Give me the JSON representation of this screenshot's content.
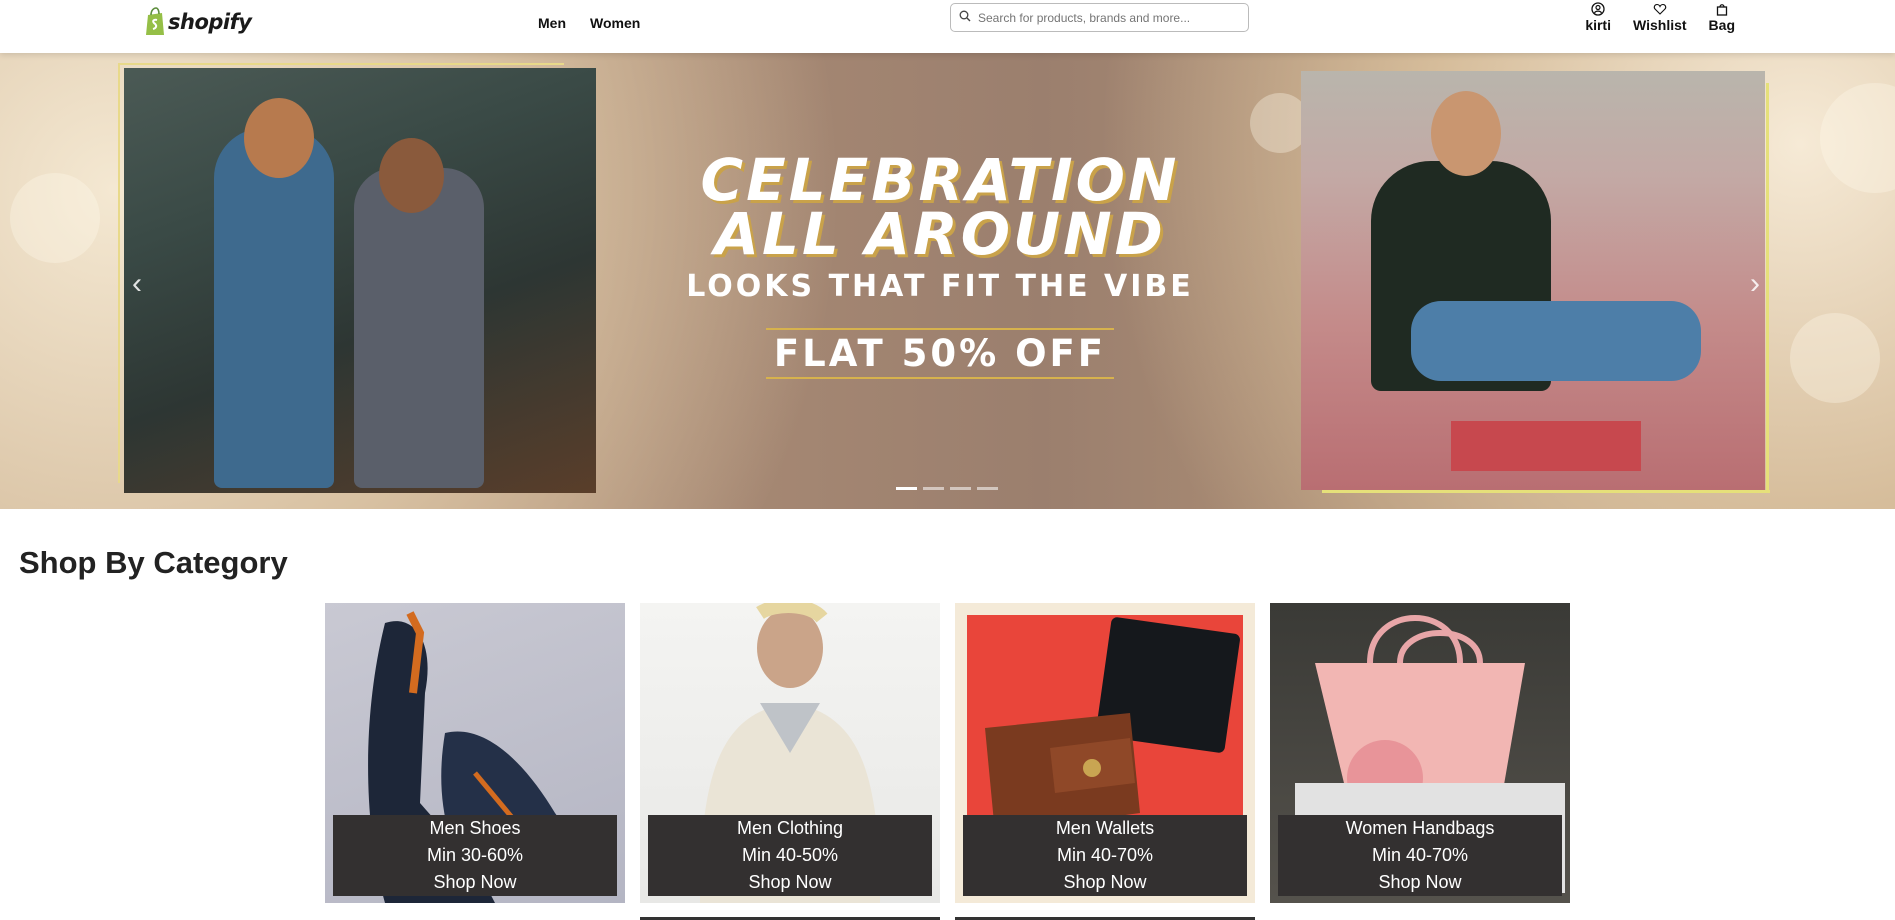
{
  "header": {
    "logo_text": "shopify",
    "nav": [
      "Men",
      "Women"
    ],
    "search_placeholder": "Search for products, brands and more...",
    "actions": {
      "profile": "kirti",
      "wishlist": "Wishlist",
      "bag": "Bag"
    }
  },
  "hero": {
    "line1": "CELEBRATION",
    "line2": "ALL AROUND",
    "line3": "LOOKS THAT FIT THE VIBE",
    "line4": "FLAT 50% OFF",
    "prev_arrow": "‹",
    "next_arrow": "›",
    "slides": 4,
    "active_slide": 1
  },
  "section": {
    "title": "Shop By Category"
  },
  "categories": [
    {
      "name": "Men Shoes",
      "discount": "Min 30-60%",
      "cta": "Shop Now"
    },
    {
      "name": "Men Clothing",
      "discount": "Min 40-50%",
      "cta": "Shop Now"
    },
    {
      "name": "Men Wallets",
      "discount": "Min 40-70%",
      "cta": "Shop Now"
    },
    {
      "name": "Women Handbags",
      "discount": "Min 40-70%",
      "cta": "Shop Now"
    }
  ],
  "colors": {
    "overlay": "#333030",
    "accent_gold": "#d7b24d",
    "shopify_green": "#95bf47"
  }
}
